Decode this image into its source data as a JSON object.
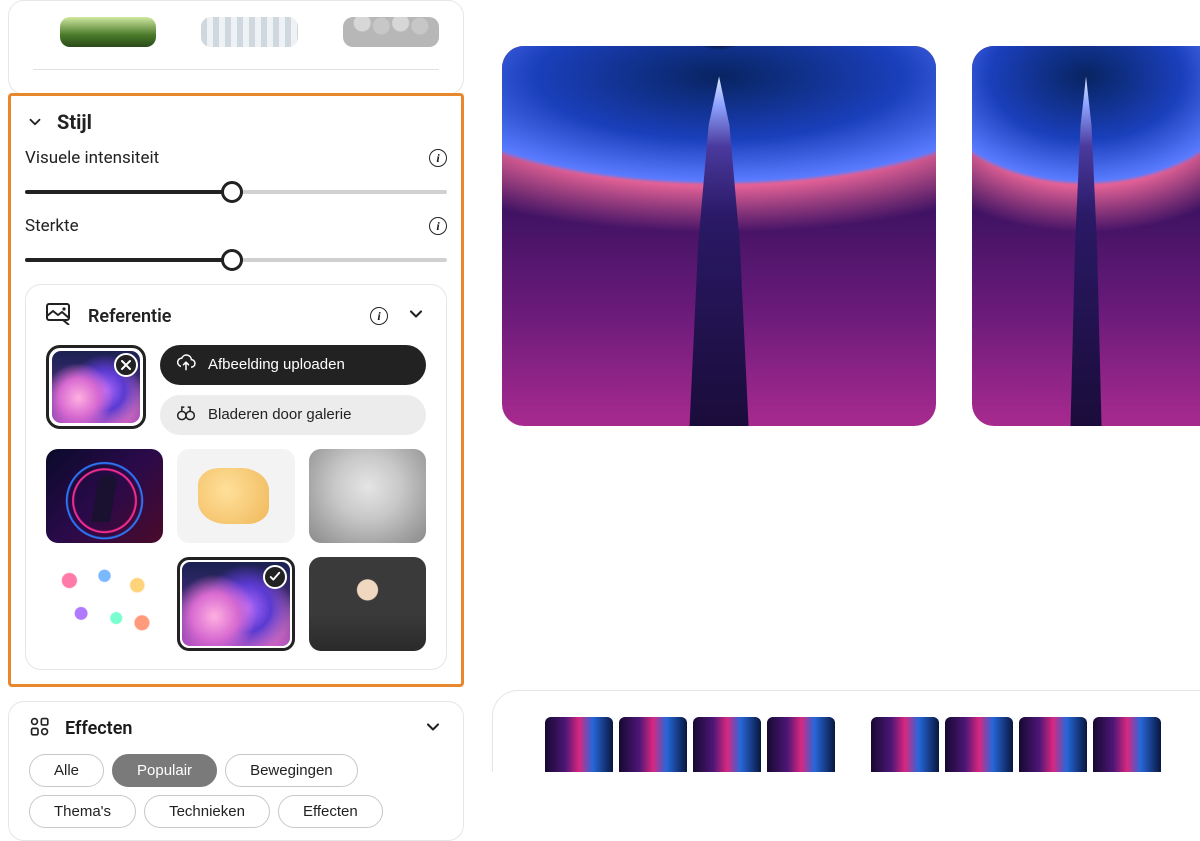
{
  "sections": {
    "stijl": {
      "title": "Stijl",
      "visual_intensity_label": "Visuele intensiteit",
      "strength_label": "Sterkte"
    },
    "reference": {
      "title": "Referentie",
      "upload_label": "Afbeelding uploaden",
      "browse_label": "Bladeren door galerie"
    },
    "effects": {
      "title": "Effecten",
      "pills": {
        "all": "Alle",
        "popular": "Populair",
        "movements": "Bewegingen",
        "themes": "Thema's",
        "techniques": "Technieken",
        "effects": "Effecten"
      }
    }
  },
  "sliders": {
    "visual_intensity": {
      "percent": 49
    },
    "strength": {
      "percent": 49
    }
  }
}
